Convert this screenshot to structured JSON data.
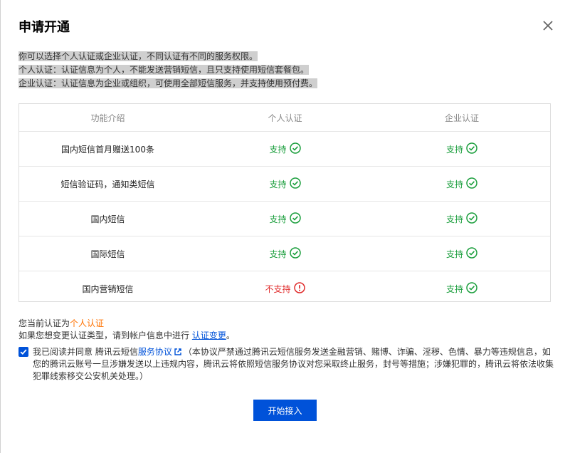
{
  "dialog": {
    "title": "申请开通",
    "intro": [
      "你可以选择个人认证或企业认证，不同认证有不同的服务权限。",
      "个人认证：认证信息为个人，不能发送营销短信，且只支持使用短信套餐包。",
      "企业认证：认证信息为企业或组织，可使用全部短信服务，并支持使用预付费。"
    ]
  },
  "table": {
    "headers": [
      "功能介绍",
      "个人认证",
      "企业认证"
    ],
    "rows": [
      {
        "feature": "国内短信首月赠送100条",
        "personal": "支持",
        "enterprise": "支持",
        "personal_ok": true
      },
      {
        "feature": "短信验证码，通知类短信",
        "personal": "支持",
        "enterprise": "支持",
        "personal_ok": true
      },
      {
        "feature": "国内短信",
        "personal": "支持",
        "enterprise": "支持",
        "personal_ok": true
      },
      {
        "feature": "国际短信",
        "personal": "支持",
        "enterprise": "支持",
        "personal_ok": true
      },
      {
        "feature": "国内营销短信",
        "personal": "不支持",
        "enterprise": "支持",
        "personal_ok": false
      }
    ]
  },
  "current": {
    "prefix": "您当前认证为",
    "type": "个人认证",
    "change_prefix": "如果您想变更认证类型，请到帐户信息中进行",
    "change_link": "认证变更",
    "change_suffix": "。"
  },
  "agreement": {
    "checked": true,
    "prefix": "我已阅读并同意 腾讯云短信",
    "link": "服务协议",
    "text": "（本协议严禁通过腾讯云短信服务发送金融营销、赌博、诈骗、淫秽、色情、暴力等违规信息，如您的腾讯云账号一旦涉嫌发送以上违规内容，腾讯云将依照短信服务协议对您采取终止服务，封号等措施；涉嫌犯罪的，腾讯云将依法收集犯罪线索移交公安机关处理。）"
  },
  "button": {
    "label": "开始接入"
  },
  "colors": {
    "primary": "#0052d9",
    "success": "#1a9e3c",
    "danger": "#e02c2c",
    "highlight": "#ff7200"
  },
  "icons": {
    "close": "close-icon",
    "ok": "check-circle-icon",
    "no": "exclamation-circle-icon",
    "external": "external-link-icon"
  }
}
